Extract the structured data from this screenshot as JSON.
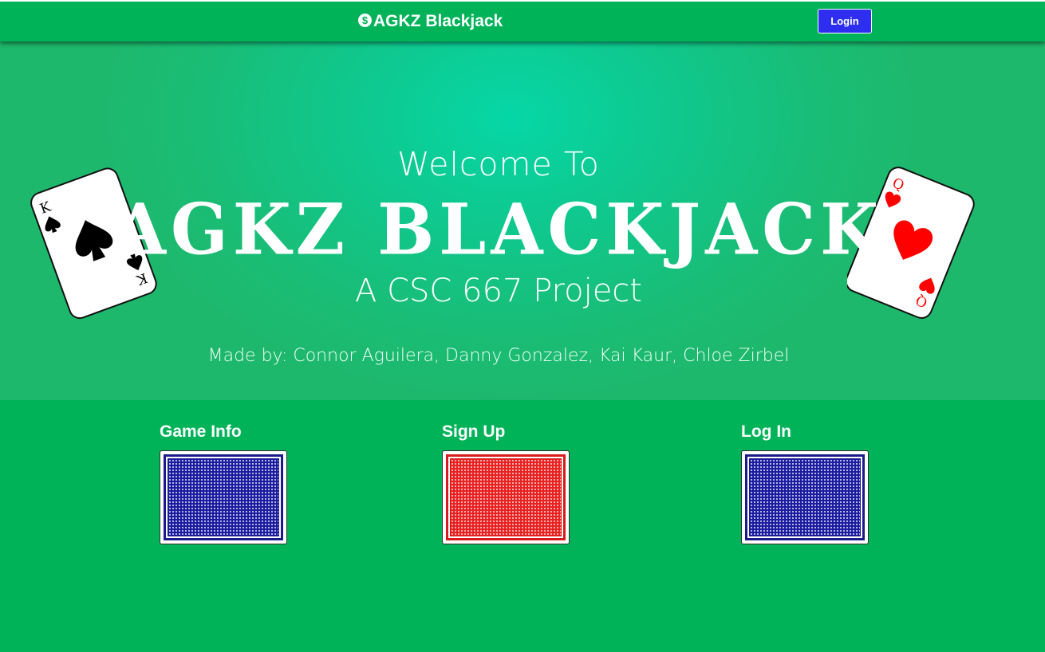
{
  "navbar": {
    "brand_icon": "$",
    "brand_text": "AGKZ Blackjack",
    "login_label": "Login"
  },
  "hero": {
    "welcome": "Welcome To",
    "title": "AGKZ BLACKJACK",
    "subtitle": "A CSC 667 Project",
    "credits": "Made by: Connor Aguilera, Danny Gonzalez, Kai Kaur, Chloe Zirbel",
    "left_card": {
      "rank": "K",
      "suit": "spades",
      "suit_symbol": "♠",
      "color": "#000000"
    },
    "right_card": {
      "rank": "Q",
      "suit": "hearts",
      "suit_symbol": "♥",
      "color": "#ff0000"
    }
  },
  "options": [
    {
      "label": "Game Info",
      "card_back": "blue"
    },
    {
      "label": "Sign Up",
      "card_back": "red"
    },
    {
      "label": "Log In",
      "card_back": "blue"
    }
  ],
  "colors": {
    "page_green": "#00b359",
    "hero_center": "#06d7a6",
    "login_button": "#2e2ef0",
    "card_blue": "#1a1aa0",
    "card_red": "#e82020"
  }
}
